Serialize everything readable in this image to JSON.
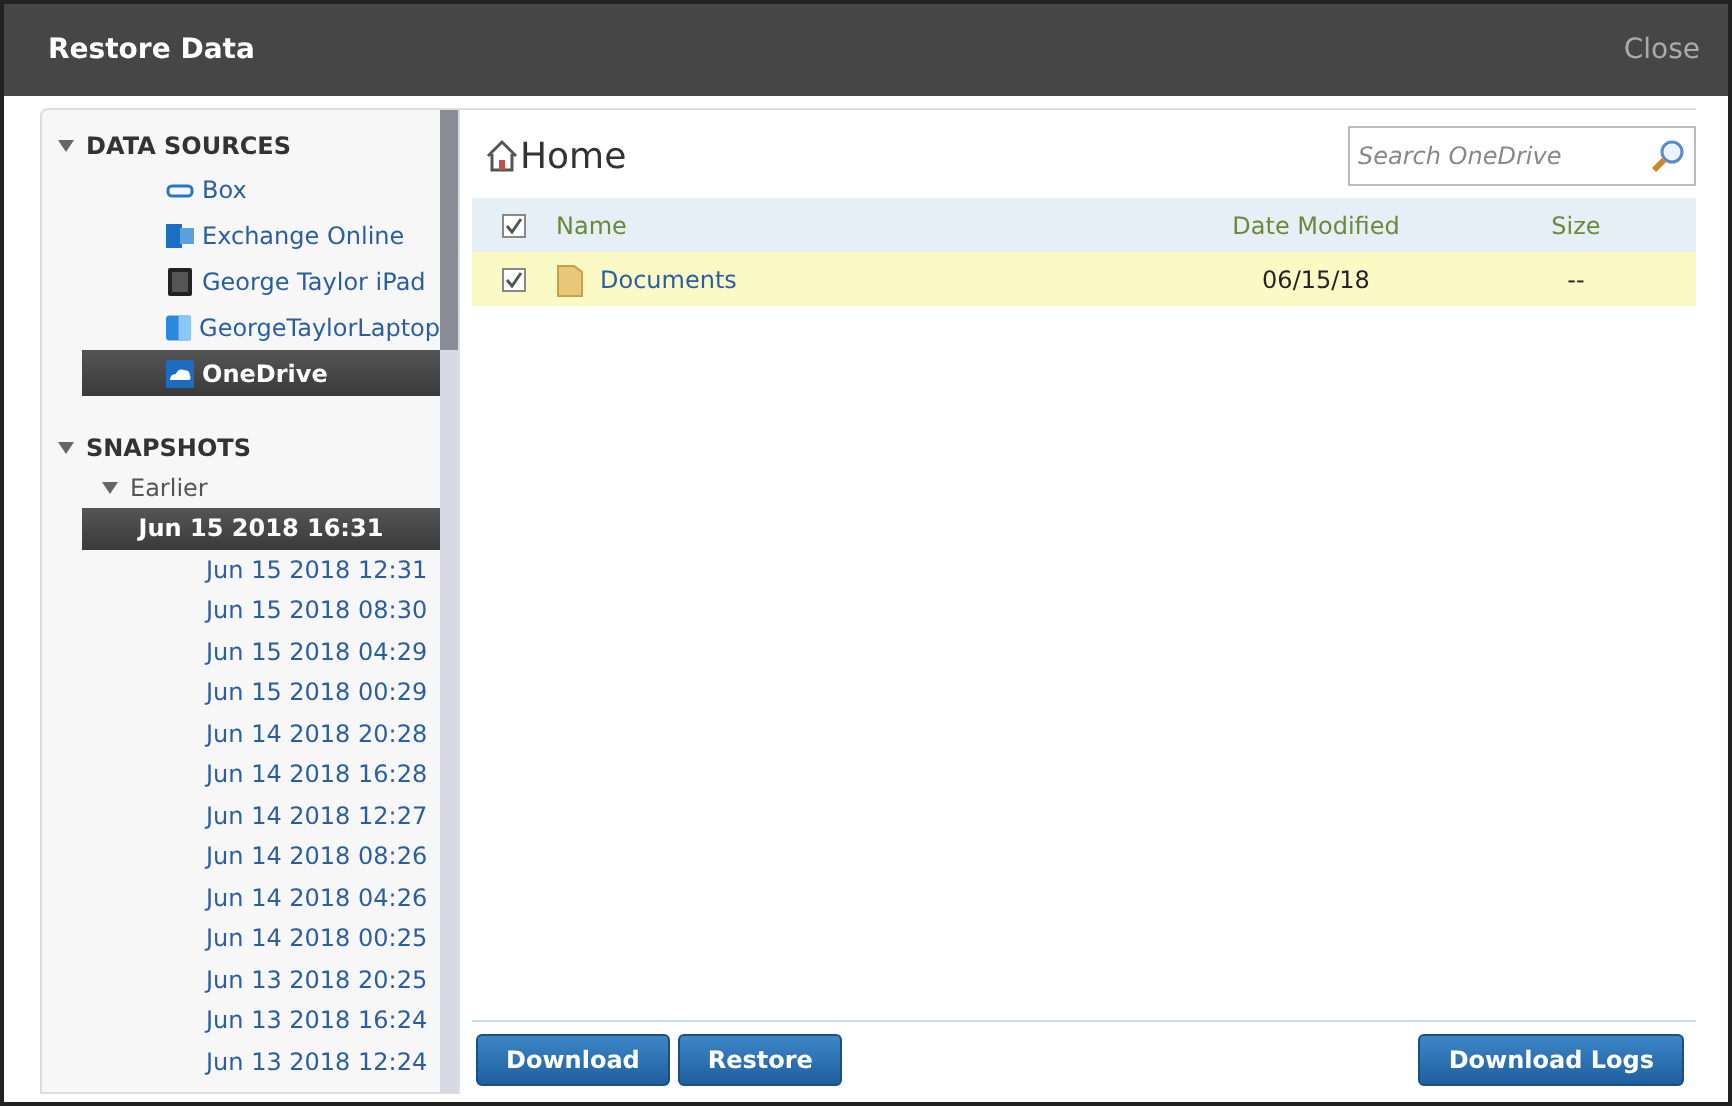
{
  "window": {
    "title": "Restore Data",
    "close": "Close"
  },
  "data_sources": {
    "heading": "DATA SOURCES",
    "expanded": true,
    "items": [
      {
        "label": "Box",
        "kind": "box",
        "selected": false
      },
      {
        "label": "Exchange Online",
        "kind": "exchange",
        "selected": false
      },
      {
        "label": "George Taylor iPad",
        "kind": "ipad",
        "selected": false
      },
      {
        "label": "GeorgeTaylorLaptop",
        "kind": "laptop",
        "selected": false
      },
      {
        "label": "OneDrive",
        "kind": "onedrive",
        "selected": true
      }
    ]
  },
  "snapshots": {
    "heading": "SNAPSHOTS",
    "expanded": true,
    "groups": [
      {
        "label": "Earlier",
        "expanded": true,
        "children": [
          {
            "label": "Jun 15 2018 16:31",
            "selected": true
          },
          {
            "label": "Jun 15 2018 12:31",
            "selected": false
          },
          {
            "label": "Jun 15 2018 08:30",
            "selected": false
          },
          {
            "label": "Jun 15 2018 04:29",
            "selected": false
          },
          {
            "label": "Jun 15 2018 00:29",
            "selected": false
          },
          {
            "label": "Jun 14 2018 20:28",
            "selected": false
          },
          {
            "label": "Jun 14 2018 16:28",
            "selected": false
          },
          {
            "label": "Jun 14 2018 12:27",
            "selected": false
          },
          {
            "label": "Jun 14 2018 08:26",
            "selected": false
          },
          {
            "label": "Jun 14 2018 04:26",
            "selected": false
          },
          {
            "label": "Jun 14 2018 00:25",
            "selected": false
          },
          {
            "label": "Jun 13 2018 20:25",
            "selected": false
          },
          {
            "label": "Jun 13 2018 16:24",
            "selected": false
          },
          {
            "label": "Jun 13 2018 12:24",
            "selected": false
          }
        ]
      }
    ]
  },
  "breadcrumb": "Home",
  "search": {
    "placeholder": "Search OneDrive"
  },
  "table": {
    "all_checked": true,
    "columns": [
      "Name",
      "Date Modified",
      "Size"
    ],
    "rows": [
      {
        "name": "Documents",
        "date_modified": "06/15/18",
        "size": "--",
        "checked": true,
        "selected": true
      }
    ]
  },
  "buttons": [
    "Download",
    "Restore"
  ],
  "right_button": "Download Logs"
}
